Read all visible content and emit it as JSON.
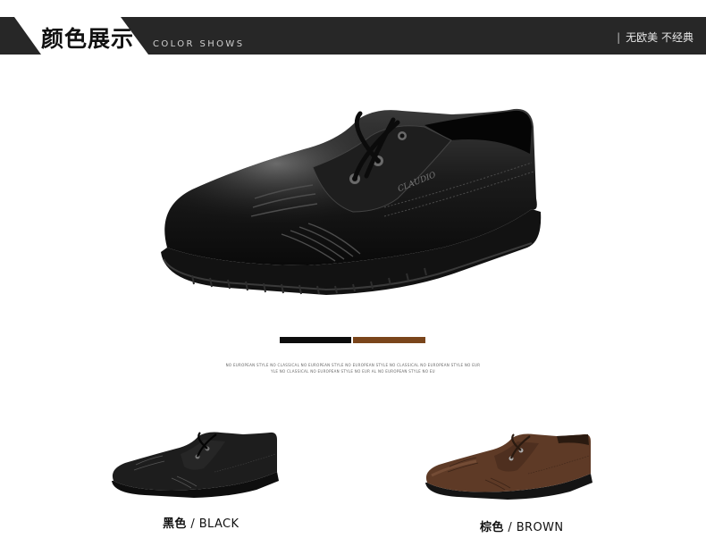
{
  "header": {
    "title_cn": "颜色展示",
    "title_en": "COLOR SHOWS",
    "slogan_separator": "|",
    "slogan": "无欧美 不经典"
  },
  "swatches": {
    "colors": [
      "#0d0d0d",
      "#7a451b"
    ]
  },
  "fine_print": {
    "line1": "NO EUROPEAN STYLE NO CLASSICAL NO EUROPEAN STYLE NO EUROPEAN STYLE NO CLASSICAL NO EUROPEAN STYLE NO EUR",
    "line2": "YLE NO CLASSICAL NO EUROPEAN STYLE NO EUR AL NO EUROPEAN STYLE NO EU"
  },
  "variants": [
    {
      "color_cn": "黑色",
      "separator": "/",
      "color_en": "BLACK",
      "swatch": "#0d0d0d"
    },
    {
      "color_cn": "棕色",
      "separator": "/",
      "color_en": "BROWN",
      "swatch": "#5e3a26"
    }
  ],
  "shoe_brand_mark": "CLAUDIO"
}
